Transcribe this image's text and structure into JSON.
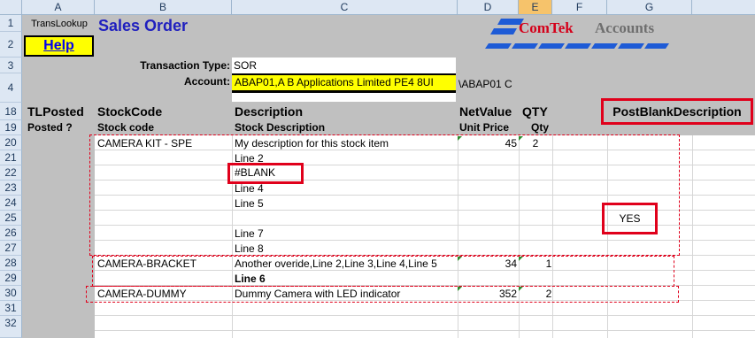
{
  "columns": [
    "A",
    "B",
    "C",
    "D",
    "E",
    "F",
    "G"
  ],
  "selected_column": "E",
  "rows": [
    "1",
    "2",
    "3",
    "4",
    "18",
    "19",
    "20",
    "21",
    "22",
    "23",
    "24",
    "25",
    "26",
    "27",
    "28",
    "29",
    "30",
    "31",
    "32"
  ],
  "header_block": {
    "translookup": "TransLookup",
    "help": "Help",
    "title": "Sales Order",
    "logo_part1": "ComTek",
    "logo_part2": "Accounts",
    "transaction_type_label": "Transaction Type:",
    "transaction_type_value": "SOR",
    "account_label": "Account:",
    "account_value": "ABAP01,A B Applications Limited PE4 8UI",
    "account_code": "\\ABAP01 C"
  },
  "table_headers": {
    "tlposted": "TLPosted",
    "posted": "Posted ?",
    "stockcode": "StockCode",
    "stockcode_sub": "Stock code",
    "description": "Description",
    "description_sub": "Stock Description",
    "netvalue": "NetValue",
    "unitprice": "Unit Price",
    "qty": "QTY",
    "qty_sub": "Qty",
    "postblank": "PostBlankDescription"
  },
  "lines": [
    {
      "stockcode": "CAMERA KIT - SPE",
      "description": "My description for this stock item",
      "price": "45",
      "qty": "2"
    },
    {
      "description": "Line 2"
    },
    {
      "description": "#BLANK"
    },
    {
      "description": "Line 4"
    },
    {
      "description": "Line 5"
    },
    {
      "postblank": "YES"
    },
    {
      "description": "Line 7"
    },
    {
      "description": "Line 8"
    },
    {
      "stockcode": "CAMERA-BRACKET",
      "description": "Another overide,Line 2,Line 3,Line 4,Line 5",
      "price": "34",
      "qty": "1"
    },
    {
      "description": "Line 6"
    },
    {
      "stockcode": "CAMERA-DUMMY",
      "description": "Dummy Camera with LED indicator",
      "price": "352",
      "qty": "2"
    }
  ],
  "colors": {
    "accent_red": "#e0001b",
    "title_blue": "#1f1fbf",
    "help_yellow": "#ffff00",
    "logo_red": "#d4001a"
  }
}
